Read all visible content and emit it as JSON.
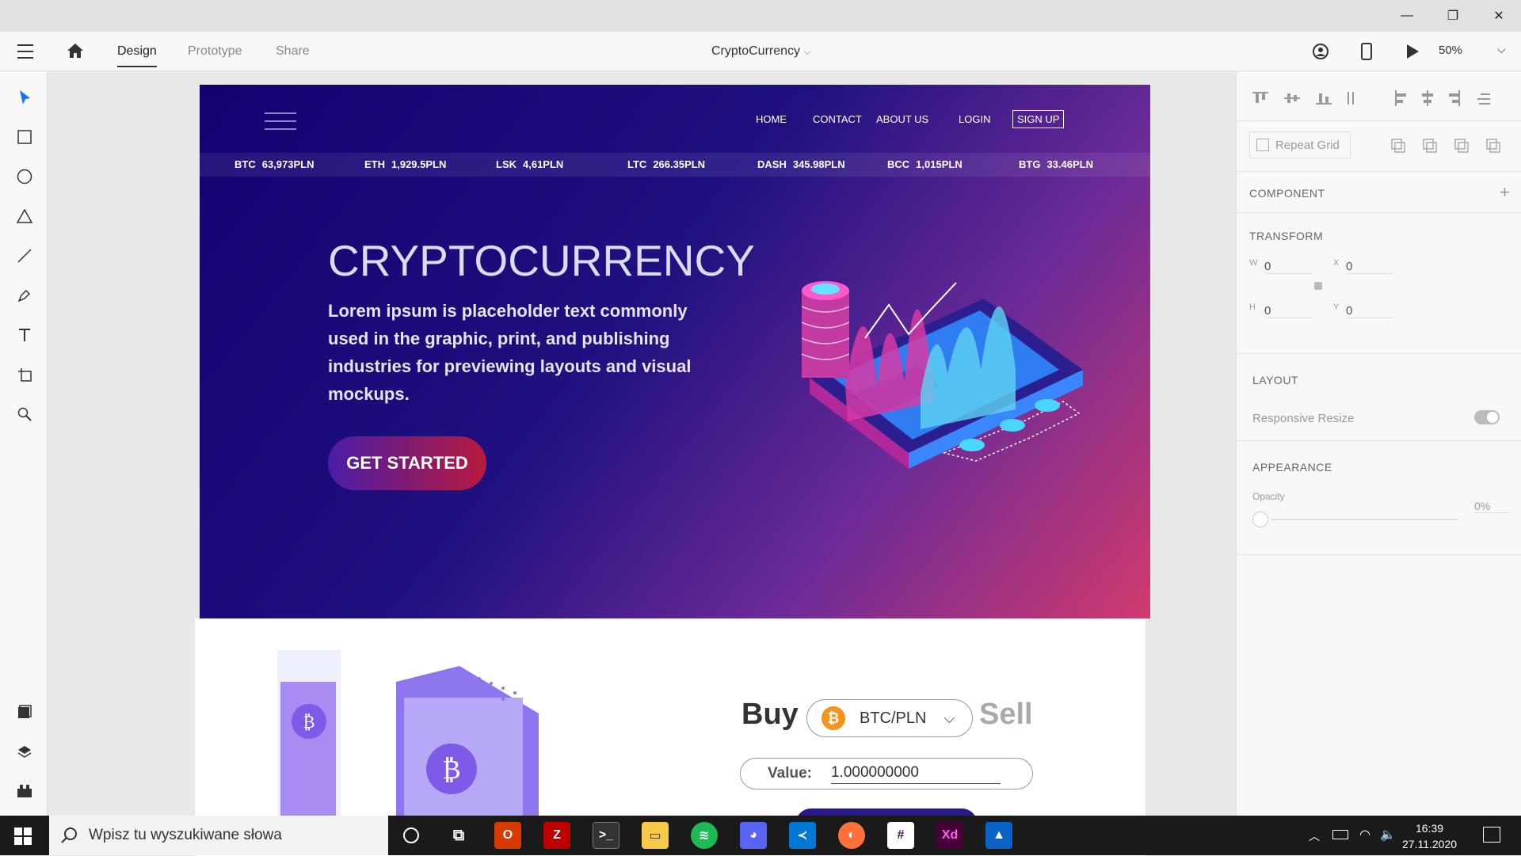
{
  "window": {
    "minimize": "—",
    "maximize": "❐",
    "close": "✕"
  },
  "appbar": {
    "tabs": [
      {
        "label": "Design"
      },
      {
        "label": "Prototype"
      },
      {
        "label": "Share"
      }
    ],
    "document_title": "CryptoCurrency",
    "zoom": "50%"
  },
  "left_tools": [
    "select-icon",
    "rectangle-icon",
    "ellipse-icon",
    "polygon-icon",
    "line-icon",
    "pen-icon",
    "text-icon",
    "artboard-icon",
    "zoom-icon",
    "assets-icon",
    "layers-icon",
    "plugins-icon"
  ],
  "right_panel": {
    "repeat_grid": "Repeat Grid",
    "component": "COMPONENT",
    "transform": "TRANSFORM",
    "w_label": "W",
    "w_value": "0",
    "x_label": "X",
    "x_value": "0",
    "h_label": "H",
    "h_value": "0",
    "y_label": "Y",
    "y_value": "0",
    "layout": "LAYOUT",
    "responsive_resize": "Responsive Resize",
    "appearance": "APPEARANCE",
    "opacity_label": "Opacity",
    "opacity_value": "0%"
  },
  "site": {
    "nav": [
      {
        "label": "HOME"
      },
      {
        "label": "CONTACT"
      },
      {
        "label": "ABOUT US"
      },
      {
        "label": "LOGIN"
      },
      {
        "label": "SIGN UP"
      }
    ],
    "ticker": [
      {
        "sym": "BTC",
        "price": "63,973PLN"
      },
      {
        "sym": "ETH",
        "price": "1,929.5PLN"
      },
      {
        "sym": "LSK",
        "price": "4,61PLN"
      },
      {
        "sym": "LTC",
        "price": "266.35PLN"
      },
      {
        "sym": "DASH",
        "price": "345.98PLN"
      },
      {
        "sym": "BCC",
        "price": "1,015PLN"
      },
      {
        "sym": "BTG",
        "price": "33.46PLN"
      }
    ],
    "hero_title": "CRYPTOCURRENCY",
    "hero_text": "Lorem ipsum is placeholder text commonly used in the graphic, print, and publishing industries for previewing layouts and visual mockups.",
    "cta": "GET STARTED",
    "buy": "Buy",
    "pair": "BTC/PLN",
    "sell": "Sell",
    "value_label": "Value:",
    "value": "1.000000000"
  },
  "taskbar": {
    "search_placeholder": "Wpisz tu wyszukiwane słowa",
    "time": "16:39",
    "date": "27.11.2020"
  }
}
